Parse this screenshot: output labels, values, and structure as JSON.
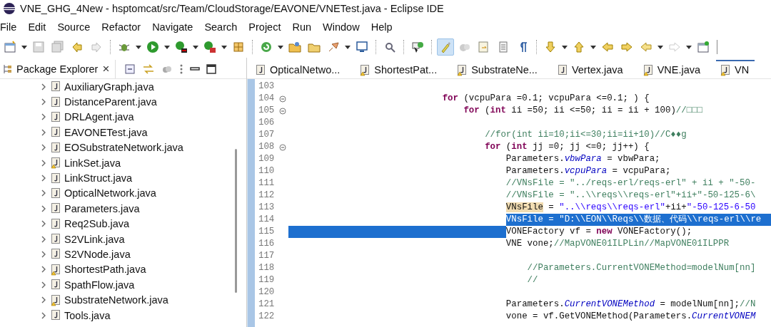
{
  "window": {
    "title": "VNE_GHG_4New - hsptomcat/src/Team/CloudStorage/EAVONE/VNETest.java - Eclipse IDE"
  },
  "menu": [
    "File",
    "Edit",
    "Source",
    "Refactor",
    "Navigate",
    "Search",
    "Project",
    "Run",
    "Window",
    "Help"
  ],
  "toolbar_buttons": [
    {
      "pressed": false
    },
    {
      "pressed": false
    },
    {
      "pressed": false
    },
    {
      "pressed": false
    },
    {
      "pressed": false
    },
    {
      "pressed": false
    },
    {
      "pressed": false
    },
    {
      "pressed": false
    },
    {
      "pressed": false
    },
    {
      "pressed": false
    },
    {
      "pressed": false
    },
    {
      "pressed": false
    },
    {
      "pressed": false
    },
    {
      "pressed": false
    },
    {
      "pressed": false
    },
    {
      "pressed": false
    },
    {
      "pressed": false
    },
    {
      "pressed": true
    },
    {
      "pressed": false
    },
    {
      "pressed": false
    },
    {
      "pressed": false
    },
    {
      "pressed": false
    },
    {
      "pressed": false
    },
    {
      "pressed": false
    },
    {
      "pressed": false
    },
    {
      "pressed": false
    },
    {
      "pressed": false
    },
    {
      "pressed": false
    },
    {
      "pressed": false
    }
  ],
  "explorer": {
    "title": "Package Explorer",
    "close": "×",
    "items": [
      {
        "label": "AuxiliaryGraph.java",
        "warning": false,
        "expanded": false
      },
      {
        "label": "DistanceParent.java",
        "warning": false,
        "expanded": false
      },
      {
        "label": "DRLAgent.java",
        "warning": false,
        "expanded": false
      },
      {
        "label": "EAVONETest.java",
        "warning": false,
        "expanded": false
      },
      {
        "label": "EOSubstrateNetwork.java",
        "warning": false,
        "expanded": false
      },
      {
        "label": "LinkSet.java",
        "warning": true,
        "expanded": false
      },
      {
        "label": "LinkStruct.java",
        "warning": false,
        "expanded": false
      },
      {
        "label": "OpticalNetwork.java",
        "warning": false,
        "expanded": false
      },
      {
        "label": "Parameters.java",
        "warning": false,
        "expanded": false
      },
      {
        "label": "Req2Sub.java",
        "warning": false,
        "expanded": false
      },
      {
        "label": "S2VLink.java",
        "warning": false,
        "expanded": false
      },
      {
        "label": "S2VNode.java",
        "warning": false,
        "expanded": false
      },
      {
        "label": "ShortestPath.java",
        "warning": true,
        "expanded": false
      },
      {
        "label": "SpathFlow.java",
        "warning": false,
        "expanded": false
      },
      {
        "label": "SubstrateNetwork.java",
        "warning": true,
        "expanded": false
      },
      {
        "label": "Tools.java",
        "warning": false,
        "expanded": false
      }
    ]
  },
  "editor_tabs": [
    {
      "label": "OpticalNetwo...",
      "warning": false,
      "selected": false
    },
    {
      "label": "ShortestPat...",
      "warning": true,
      "selected": false
    },
    {
      "label": "SubstrateNe...",
      "warning": true,
      "selected": false
    },
    {
      "label": "Vertex.java",
      "warning": false,
      "selected": false
    },
    {
      "label": "VNE.java",
      "warning": true,
      "selected": false
    },
    {
      "label": "VN",
      "warning": true,
      "selected": true
    }
  ],
  "code_lines": [
    {
      "number": "103"
    },
    {
      "number": "104",
      "foldable": true,
      "segments": [
        {
          "kind": "keyword",
          "text": "                             for"
        },
        {
          "kind": "plain",
          "text": " (vcpuPara =0.1; vcpuPara <=0.1; ) {"
        }
      ]
    },
    {
      "number": "105",
      "foldable": true,
      "segments": [
        {
          "kind": "keyword",
          "text": "                                 for"
        },
        {
          "kind": "plain",
          "text": " ("
        },
        {
          "kind": "keyword",
          "text": "int"
        },
        {
          "kind": "plain",
          "text": " ii =50; ii <=50; ii = ii + 100)"
        },
        {
          "kind": "comment",
          "text": "//□□□"
        }
      ]
    },
    {
      "number": "106"
    },
    {
      "number": "107",
      "segments": [
        {
          "kind": "comment",
          "text": "                                     //for(int ii=10;ii<=30;ii=ii+10)//C♦♦g"
        }
      ]
    },
    {
      "number": "108",
      "foldable": true,
      "segments": [
        {
          "kind": "keyword",
          "text": "                                     for"
        },
        {
          "kind": "plain",
          "text": " ("
        },
        {
          "kind": "keyword",
          "text": "int"
        },
        {
          "kind": "plain",
          "text": " jj =0; jj <=0; jj++) {"
        }
      ]
    },
    {
      "number": "109",
      "segments": [
        {
          "kind": "plain",
          "text": "                                         Parameters."
        },
        {
          "kind": "field",
          "text": "vbwPara"
        },
        {
          "kind": "plain",
          "text": " = vbwPara;"
        }
      ]
    },
    {
      "number": "110",
      "segments": [
        {
          "kind": "plain",
          "text": "                                         Parameters."
        },
        {
          "kind": "field",
          "text": "vcpuPara"
        },
        {
          "kind": "plain",
          "text": " = vcpuPara;"
        }
      ]
    },
    {
      "number": "111",
      "segments": [
        {
          "kind": "comment",
          "text": "                                         //VNsFile = \"../reqs-erl/reqs-erl\" + ii + \"-50-"
        }
      ]
    },
    {
      "number": "112",
      "segments": [
        {
          "kind": "comment",
          "text": "                                         //VNsFile = \"..\\\\reqs\\\\reqs-erl\"+ii+\"-50-125-6\\"
        }
      ]
    },
    {
      "number": "113",
      "segments": [
        {
          "kind": "occurrence",
          "text": "                                         VNsFile"
        },
        {
          "kind": "plain",
          "text": " = "
        },
        {
          "kind": "string",
          "text": "\"..\\\\reqs\\\\reqs-erl\""
        },
        {
          "kind": "plain",
          "text": "+ii+"
        },
        {
          "kind": "string",
          "text": "\"-50-125-6-50"
        }
      ]
    },
    {
      "number": "114",
      "text_selected": true,
      "segments": [
        {
          "kind": "plain",
          "text": "                                         VNsFile = \"D:\\\\EON\\\\Reqs\\\\数据、代码\\\\reqs-erl\\\\re"
        }
      ]
    },
    {
      "number": "115",
      "indent_selected": true,
      "segments": [
        {
          "kind": "plain",
          "text": "                                         VONEFactory vf = "
        },
        {
          "kind": "keyword",
          "text": "new"
        },
        {
          "kind": "plain",
          "text": " VONEFactory();"
        }
      ]
    },
    {
      "number": "116",
      "segments": [
        {
          "kind": "plain",
          "text": "                                         VNE vone;"
        },
        {
          "kind": "comment",
          "text": "//MapVONE01ILPLin//MapVONE01ILPPR"
        }
      ]
    },
    {
      "number": "117"
    },
    {
      "number": "118",
      "segments": [
        {
          "kind": "comment",
          "text": "                                             //Parameters.CurrentVONEMethod=modelNum[nn]"
        }
      ]
    },
    {
      "number": "119",
      "segments": [
        {
          "kind": "comment",
          "text": "                                             //"
        }
      ]
    },
    {
      "number": "120"
    },
    {
      "number": "121",
      "segments": [
        {
          "kind": "plain",
          "text": "                                         Parameters."
        },
        {
          "kind": "field",
          "text": "CurrentVONEMethod"
        },
        {
          "kind": "plain",
          "text": " = modelNum[nn];"
        },
        {
          "kind": "comment",
          "text": "//N"
        }
      ]
    },
    {
      "number": "122",
      "segments": [
        {
          "kind": "plain",
          "text": "                                         vone = vf.GetVONEMethod(Parameters."
        },
        {
          "kind": "field",
          "text": "CurrentVONEM"
        }
      ]
    }
  ]
}
